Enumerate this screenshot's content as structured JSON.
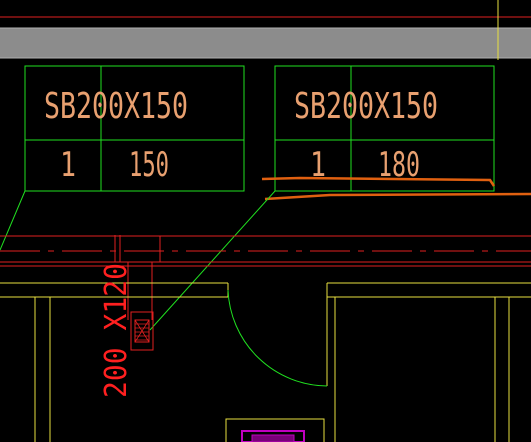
{
  "colors": {
    "background": "#000000",
    "band_gray": "#8c8c8c",
    "green_line": "#20e020",
    "yellow_line": "#e8e040",
    "red_line": "#e02020",
    "text_tan": "#e8a070",
    "orange_line": "#e06010",
    "purple": "#c000c0"
  },
  "tags": [
    {
      "title": "SB200X150",
      "col1": "1",
      "col2": "150"
    },
    {
      "title": "SB200X150",
      "col1": "1",
      "col2": "180"
    }
  ],
  "dimension_label": "200 X120"
}
